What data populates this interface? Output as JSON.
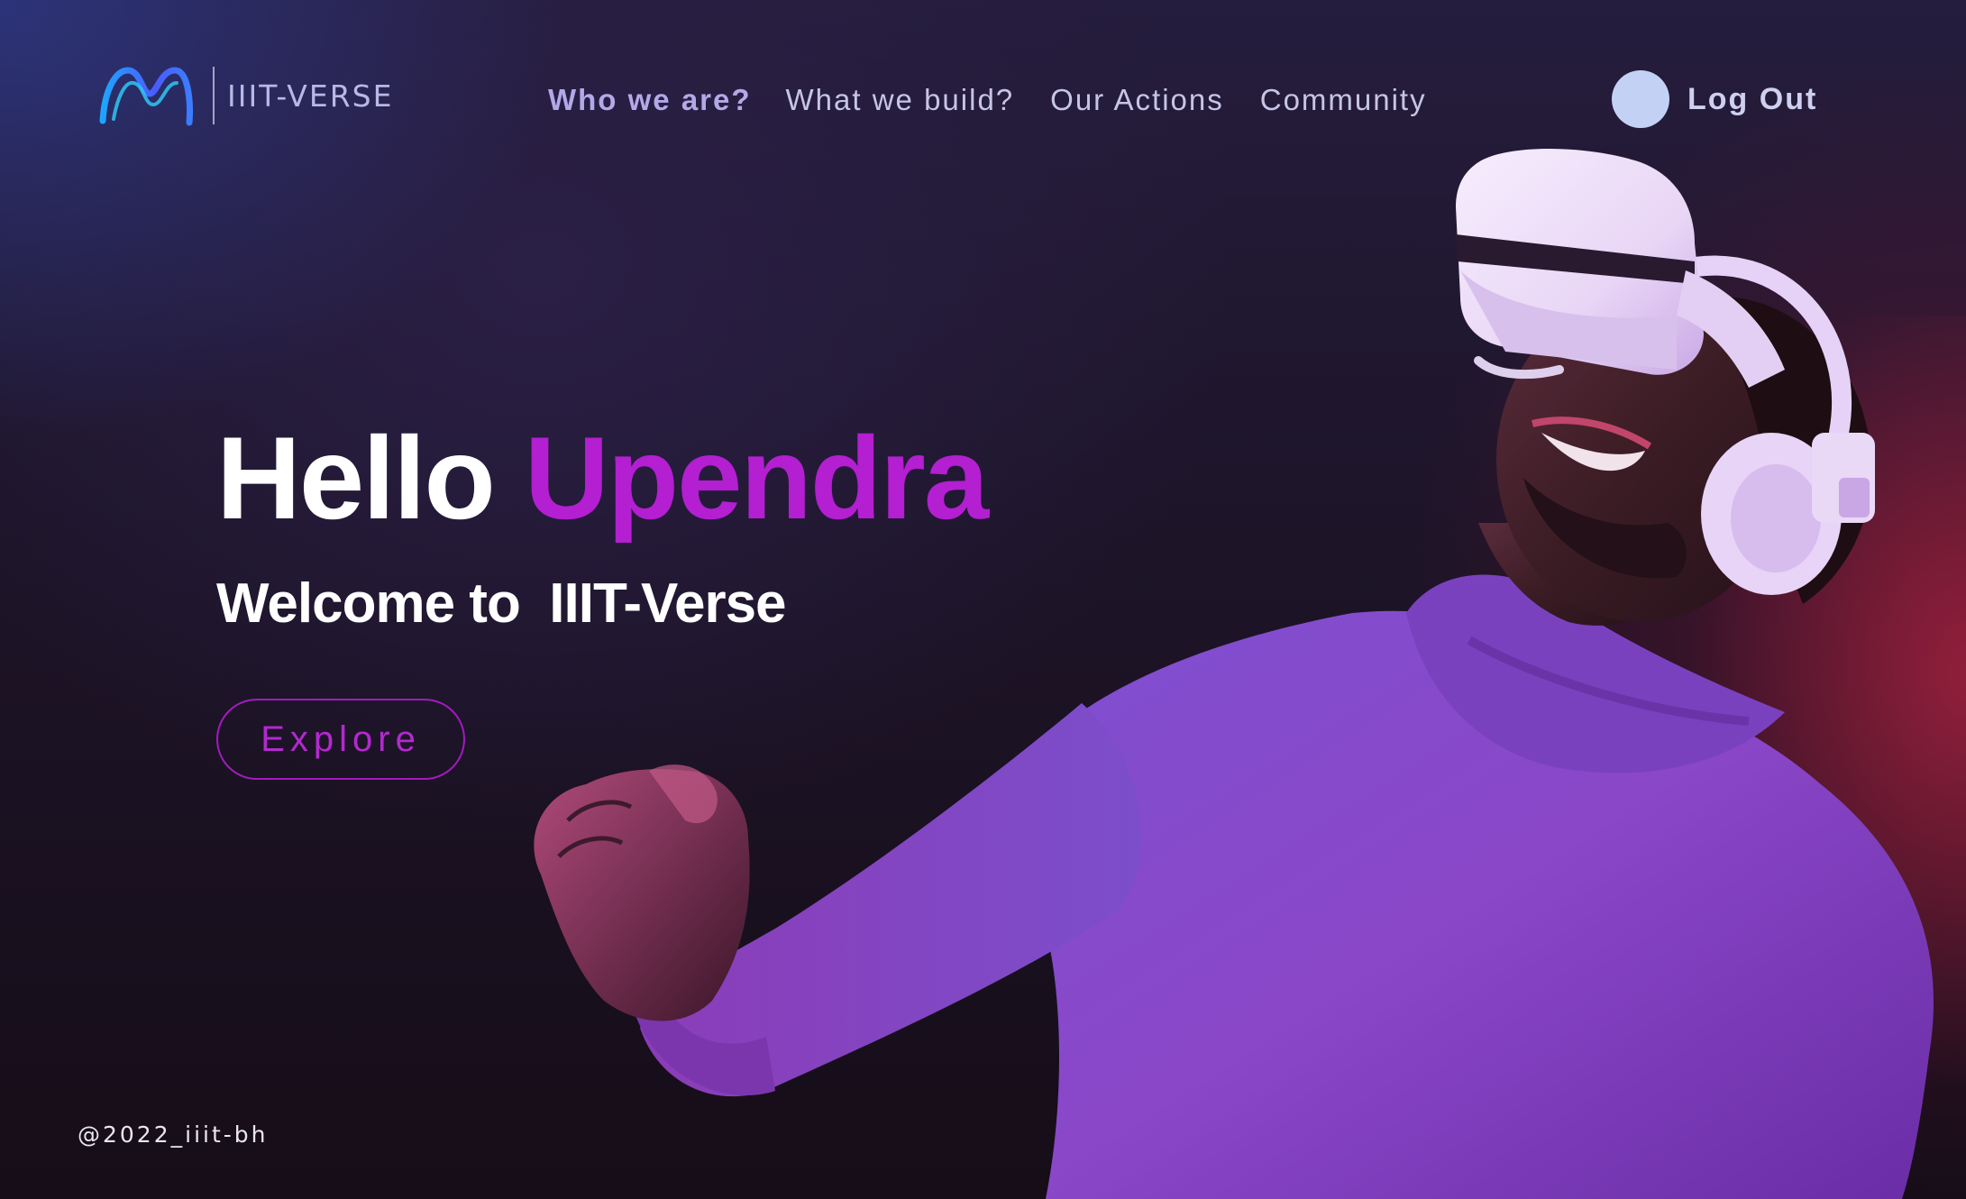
{
  "header": {
    "logo_text": "IIIT-VERSE",
    "nav": [
      {
        "label": "Who we are?",
        "active": true
      },
      {
        "label": "What we build?",
        "active": false
      },
      {
        "label": "Our Actions",
        "active": false
      },
      {
        "label": "Community",
        "active": false
      }
    ],
    "logout_label": "Log Out"
  },
  "hero": {
    "greeting_word": "Hello",
    "user_name": "Upendra",
    "welcome_text": "Welcome to  IIIT-Verse",
    "explore_label": "Explore"
  },
  "footer": {
    "handle": "@2022_iiit-bh"
  },
  "icons": {
    "logo": "meta-style-logo-icon",
    "avatar": "user-avatar"
  },
  "colors": {
    "accent": "#b31fd1",
    "nav_text": "#c6c5e6",
    "avatar": "#c3d2f4",
    "background": "#1d1428"
  }
}
